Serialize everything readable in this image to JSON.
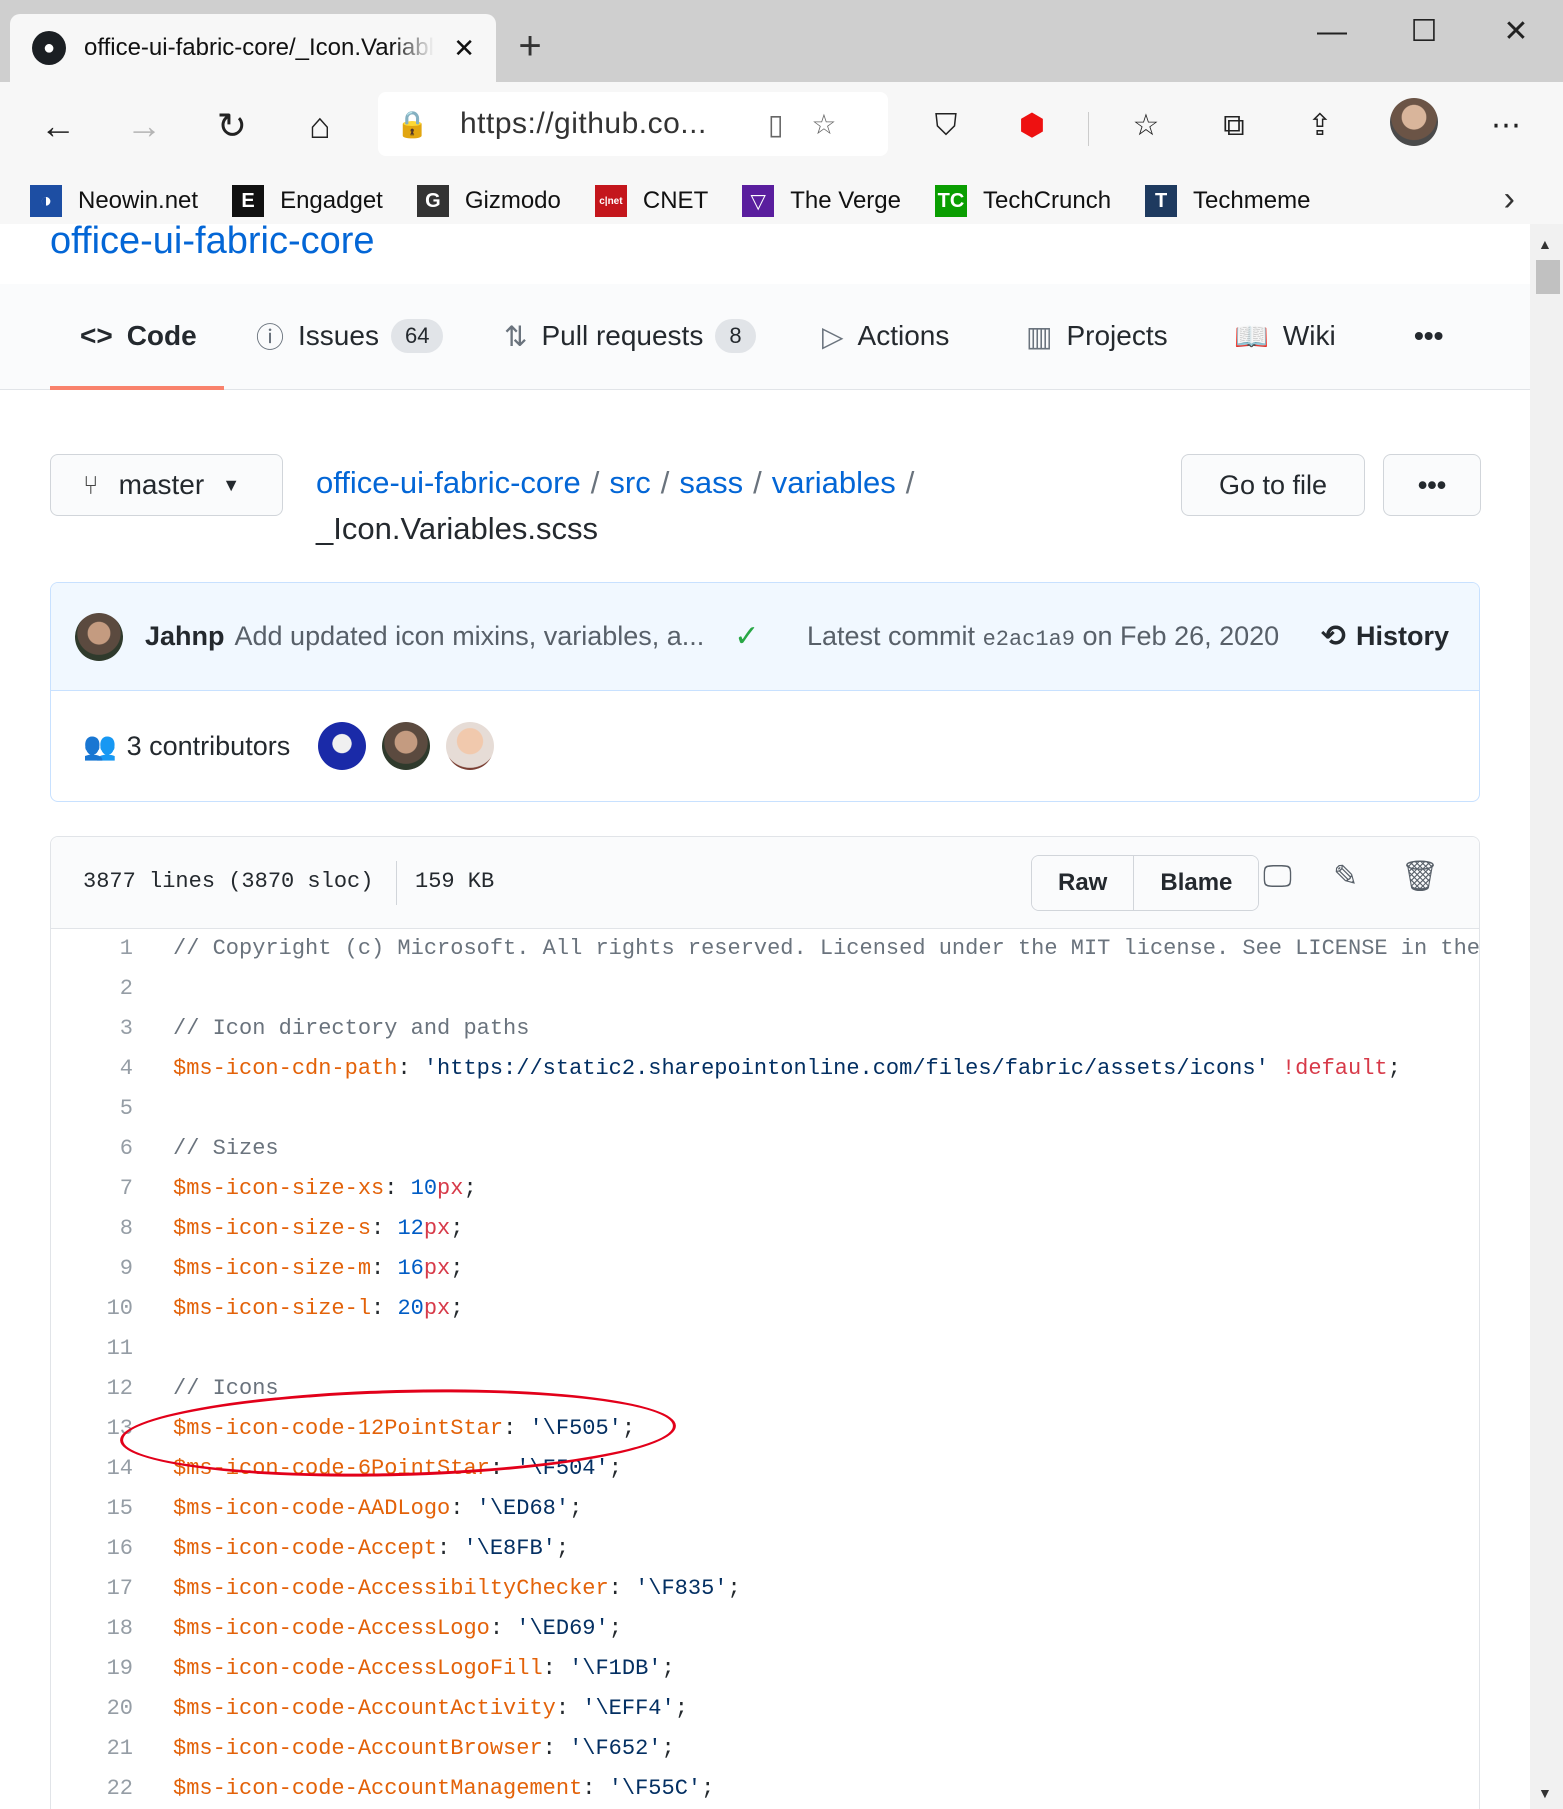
{
  "browser": {
    "tab_title": "office-ui-fabric-core/_Icon.Variables.scss",
    "new_tab": "+",
    "window_controls": {
      "minimize": "—",
      "maximize": "☐",
      "close": "✕"
    },
    "address": "https://github.co...",
    "nav_icons": [
      "back-icon",
      "forward-icon",
      "refresh-icon",
      "home-icon"
    ],
    "bookmarks": [
      {
        "label": "Neowin.net",
        "icon": "neowin-icon",
        "glyph": "◑",
        "color": "#1d4ea3"
      },
      {
        "label": "Engadget",
        "icon": "engadget-icon",
        "glyph": "E",
        "color": "#111111"
      },
      {
        "label": "Gizmodo",
        "icon": "gizmodo-icon",
        "glyph": "G",
        "color": "#333333"
      },
      {
        "label": "CNET",
        "icon": "cnet-icon",
        "glyph": "c|net",
        "color": "#c4161c"
      },
      {
        "label": "The Verge",
        "icon": "verge-icon",
        "glyph": "▽",
        "color": "#5a1e9e"
      },
      {
        "label": "TechCrunch",
        "icon": "techcrunch-icon",
        "glyph": "TC",
        "color": "#0a9e01"
      },
      {
        "label": "Techmeme",
        "icon": "techmeme-icon",
        "glyph": "T",
        "color": "#1e3a5f"
      }
    ]
  },
  "repo": {
    "name": "office-ui-fabric-core",
    "tabs": [
      {
        "label": "Code",
        "icon": "code-icon",
        "glyph": "<>",
        "count": null,
        "selected": true
      },
      {
        "label": "Issues",
        "icon": "issue-icon",
        "glyph": "ⓘ",
        "count": "64"
      },
      {
        "label": "Pull requests",
        "icon": "pull-request-icon",
        "glyph": "⇅",
        "count": "8"
      },
      {
        "label": "Actions",
        "icon": "actions-icon",
        "glyph": "▷",
        "count": null
      },
      {
        "label": "Projects",
        "icon": "projects-icon",
        "glyph": "▥",
        "count": null
      },
      {
        "label": "Wiki",
        "icon": "wiki-icon",
        "glyph": "📖",
        "count": null
      }
    ],
    "more": "•••"
  },
  "file_nav": {
    "branch": "master",
    "breadcrumb": [
      "office-ui-fabric-core",
      "src",
      "sass",
      "variables"
    ],
    "file_name": "_Icon.Variables.scss",
    "go_to_file": "Go to file",
    "more": "•••"
  },
  "commit": {
    "author": "Jahnp",
    "message": "Add updated icon mixins, variables, a...",
    "latest_label": "Latest commit",
    "sha": "e2ac1a9",
    "date_text": "on Feb 26, 2020",
    "history": "History",
    "contributors": "3 contributors"
  },
  "file": {
    "lines_info": "3877 lines (3870 sloc)",
    "size": "159 KB",
    "raw": "Raw",
    "blame": "Blame",
    "code_lines": [
      {
        "n": "1",
        "tokens": [
          {
            "t": "// Copyright (c) Microsoft. All rights reserved. Licensed under the MIT license. See LICENSE in the",
            "c": "com"
          }
        ]
      },
      {
        "n": "2",
        "tokens": []
      },
      {
        "n": "3",
        "tokens": [
          {
            "t": "// Icon directory and paths",
            "c": "com"
          }
        ]
      },
      {
        "n": "4",
        "tokens": [
          {
            "t": "$ms-icon-cdn-path",
            "c": "var"
          },
          {
            "t": ": ",
            "c": "plain"
          },
          {
            "t": "'https://static2.sharepointonline.com/files/fabric/assets/icons'",
            "c": "str"
          },
          {
            "t": " ",
            "c": "plain"
          },
          {
            "t": "!default",
            "c": "kw"
          },
          {
            "t": ";",
            "c": "plain"
          }
        ]
      },
      {
        "n": "5",
        "tokens": []
      },
      {
        "n": "6",
        "tokens": [
          {
            "t": "// Sizes",
            "c": "com"
          }
        ]
      },
      {
        "n": "7",
        "tokens": [
          {
            "t": "$ms-icon-size-xs",
            "c": "var"
          },
          {
            "t": ": ",
            "c": "plain"
          },
          {
            "t": "10",
            "c": "num"
          },
          {
            "t": "px",
            "c": "unit"
          },
          {
            "t": ";",
            "c": "plain"
          }
        ]
      },
      {
        "n": "8",
        "tokens": [
          {
            "t": "$ms-icon-size-s",
            "c": "var"
          },
          {
            "t": ": ",
            "c": "plain"
          },
          {
            "t": "12",
            "c": "num"
          },
          {
            "t": "px",
            "c": "unit"
          },
          {
            "t": ";",
            "c": "plain"
          }
        ]
      },
      {
        "n": "9",
        "tokens": [
          {
            "t": "$ms-icon-size-m",
            "c": "var"
          },
          {
            "t": ": ",
            "c": "plain"
          },
          {
            "t": "16",
            "c": "num"
          },
          {
            "t": "px",
            "c": "unit"
          },
          {
            "t": ";",
            "c": "plain"
          }
        ]
      },
      {
        "n": "10",
        "tokens": [
          {
            "t": "$ms-icon-size-l",
            "c": "var"
          },
          {
            "t": ": ",
            "c": "plain"
          },
          {
            "t": "20",
            "c": "num"
          },
          {
            "t": "px",
            "c": "unit"
          },
          {
            "t": ";",
            "c": "plain"
          }
        ]
      },
      {
        "n": "11",
        "tokens": []
      },
      {
        "n": "12",
        "tokens": [
          {
            "t": "// Icons",
            "c": "com"
          }
        ]
      },
      {
        "n": "13",
        "tokens": [
          {
            "t": "$ms-icon-code-12PointStar",
            "c": "var"
          },
          {
            "t": ": ",
            "c": "plain"
          },
          {
            "t": "'\\F505'",
            "c": "str"
          },
          {
            "t": ";",
            "c": "plain"
          }
        ]
      },
      {
        "n": "14",
        "tokens": [
          {
            "t": "$ms-icon-code-6PointStar",
            "c": "var"
          },
          {
            "t": ": ",
            "c": "plain"
          },
          {
            "t": "'\\F504'",
            "c": "str"
          },
          {
            "t": ";",
            "c": "plain"
          }
        ]
      },
      {
        "n": "15",
        "tokens": [
          {
            "t": "$ms-icon-code-AADLogo",
            "c": "var"
          },
          {
            "t": ": ",
            "c": "plain"
          },
          {
            "t": "'\\ED68'",
            "c": "str"
          },
          {
            "t": ";",
            "c": "plain"
          }
        ]
      },
      {
        "n": "16",
        "tokens": [
          {
            "t": "$ms-icon-code-Accept",
            "c": "var"
          },
          {
            "t": ": ",
            "c": "plain"
          },
          {
            "t": "'\\E8FB'",
            "c": "str"
          },
          {
            "t": ";",
            "c": "plain"
          }
        ]
      },
      {
        "n": "17",
        "tokens": [
          {
            "t": "$ms-icon-code-AccessibiltyChecker",
            "c": "var"
          },
          {
            "t": ": ",
            "c": "plain"
          },
          {
            "t": "'\\F835'",
            "c": "str"
          },
          {
            "t": ";",
            "c": "plain"
          }
        ]
      },
      {
        "n": "18",
        "tokens": [
          {
            "t": "$ms-icon-code-AccessLogo",
            "c": "var"
          },
          {
            "t": ": ",
            "c": "plain"
          },
          {
            "t": "'\\ED69'",
            "c": "str"
          },
          {
            "t": ";",
            "c": "plain"
          }
        ]
      },
      {
        "n": "19",
        "tokens": [
          {
            "t": "$ms-icon-code-AccessLogoFill",
            "c": "var"
          },
          {
            "t": ": ",
            "c": "plain"
          },
          {
            "t": "'\\F1DB'",
            "c": "str"
          },
          {
            "t": ";",
            "c": "plain"
          }
        ]
      },
      {
        "n": "20",
        "tokens": [
          {
            "t": "$ms-icon-code-AccountActivity",
            "c": "var"
          },
          {
            "t": ": ",
            "c": "plain"
          },
          {
            "t": "'\\EFF4'",
            "c": "str"
          },
          {
            "t": ";",
            "c": "plain"
          }
        ]
      },
      {
        "n": "21",
        "tokens": [
          {
            "t": "$ms-icon-code-AccountBrowser",
            "c": "var"
          },
          {
            "t": ": ",
            "c": "plain"
          },
          {
            "t": "'\\F652'",
            "c": "str"
          },
          {
            "t": ";",
            "c": "plain"
          }
        ]
      },
      {
        "n": "22",
        "tokens": [
          {
            "t": "$ms-icon-code-AccountManagement",
            "c": "var"
          },
          {
            "t": ": ",
            "c": "plain"
          },
          {
            "t": "'\\F55C'",
            "c": "str"
          },
          {
            "t": ";",
            "c": "plain"
          }
        ]
      }
    ]
  },
  "colors": {
    "link": "#0366d6",
    "selected_tab_underline": "#f9826c",
    "annotation_circle": "#e2001a",
    "success": "#28a745"
  }
}
